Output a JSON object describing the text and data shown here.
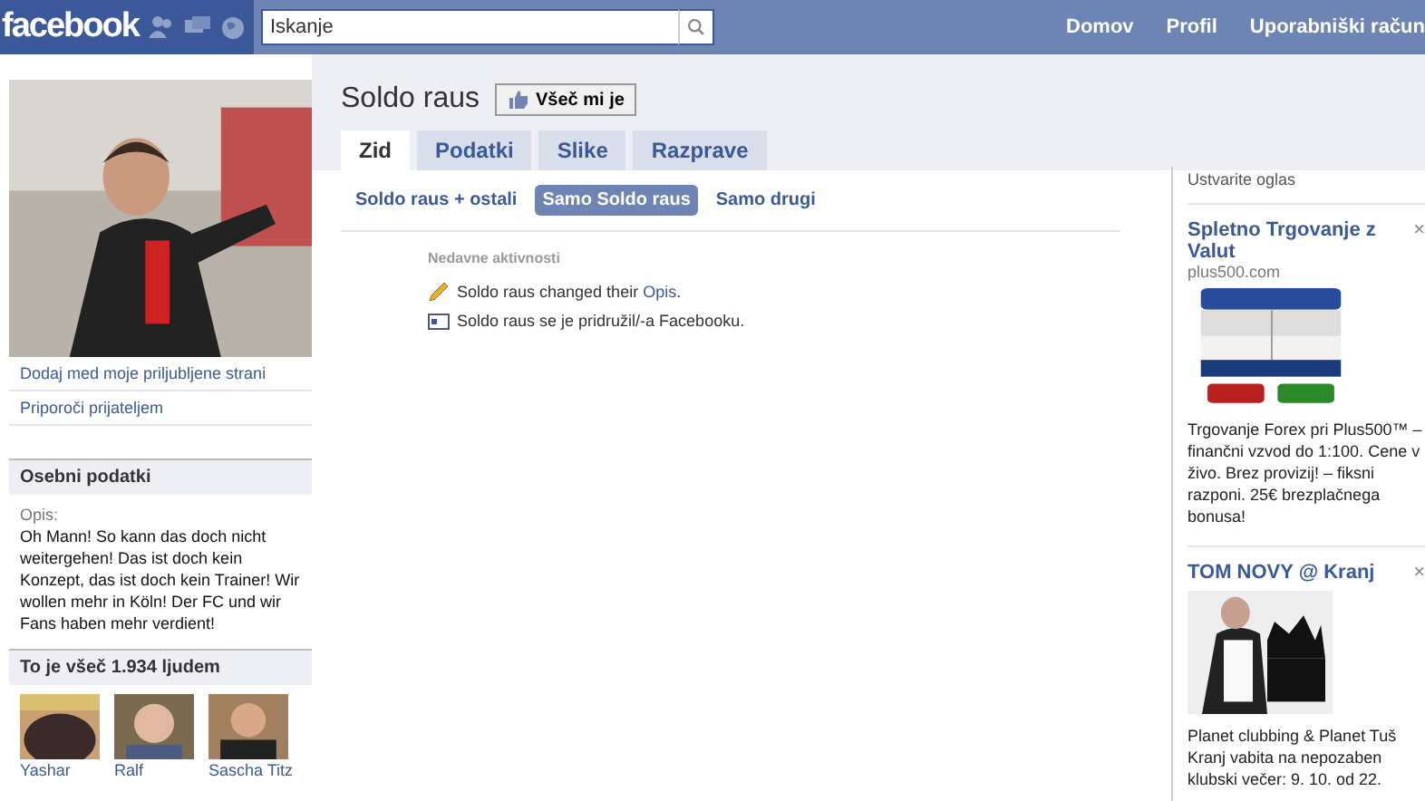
{
  "topbar": {
    "logo": "facebook",
    "search": {
      "placeholder": "Iskanje"
    },
    "nav": [
      "Domov",
      "Profil",
      "Uporabniški račun"
    ]
  },
  "sidebar": {
    "links": [
      "Dodaj med moje priljubljene strani",
      "Priporoči prijateljem"
    ],
    "info": {
      "title": "Osebni podatki",
      "label": "Opis:",
      "text": "Oh Mann! So kann das doch nicht weitergehen! Das ist doch kein Konzept, das ist doch kein Trainer! Wir wollen mehr in Köln! Der FC und wir Fans haben mehr verdient!"
    },
    "likes": {
      "title": "To je všeč 1.934 ljudem",
      "people": [
        {
          "name": "Yashar"
        },
        {
          "name": "Ralf"
        },
        {
          "name": "Sascha Titz"
        }
      ]
    }
  },
  "page": {
    "title": "Soldo raus",
    "like_button": "Všeč mi je",
    "tabs": [
      {
        "label": "Zid",
        "selected": true
      },
      {
        "label": "Podatki",
        "selected": false
      },
      {
        "label": "Slike",
        "selected": false
      },
      {
        "label": "Razprave",
        "selected": false
      }
    ],
    "filters": [
      {
        "label": "Soldo raus + ostali",
        "selected": false
      },
      {
        "label": "Samo Soldo raus",
        "selected": true
      },
      {
        "label": "Samo drugi",
        "selected": false
      }
    ],
    "activity": {
      "heading": "Nedavne aktivnosti",
      "items": [
        {
          "kind": "edit",
          "text": "Soldo raus changed their ",
          "link": "Opis",
          "end": "."
        },
        {
          "kind": "join",
          "text": "Soldo raus se je pridružil/-a Facebooku."
        }
      ]
    }
  },
  "ads": {
    "create": "Ustvarite oglas",
    "items": [
      {
        "title": "Spletno Trgovanje z Valut",
        "close": "×",
        "domain": "plus500.com",
        "text": "Trgovanje Forex pri Plus500™ – finančni vzvod do 1:100. Cene v živo. Brez provizij! – fiksni razponi. 25€ brezplačnega bonusa!",
        "kind": "chart"
      },
      {
        "title": "TOM NOVY @ Kranj",
        "close": "×",
        "text": "Planet clubbing & Planet Tuš Kranj vabita na nepozaben klubski večer: 9. 10. od 22.",
        "kind": "person"
      }
    ]
  }
}
